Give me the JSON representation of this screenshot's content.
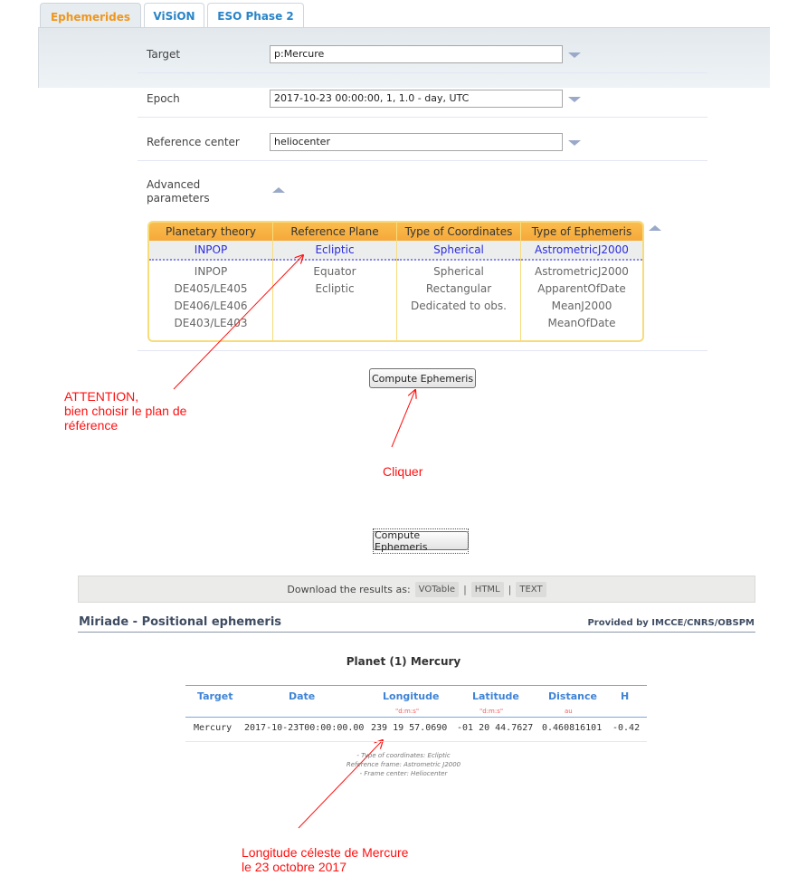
{
  "tabs": [
    {
      "label": "Ephemerides",
      "active": true
    },
    {
      "label": "ViSiON",
      "active": false
    },
    {
      "label": "ESO Phase 2",
      "active": false
    }
  ],
  "form": {
    "target": {
      "label": "Target",
      "value": "p:Mercure"
    },
    "epoch": {
      "label": "Epoch",
      "value": "2017-10-23 00:00:00, 1, 1.0 - day, UTC"
    },
    "reference_center": {
      "label": "Reference center",
      "value": "heliocenter"
    },
    "advanced": {
      "label_line1": "Advanced",
      "label_line2": "parameters"
    }
  },
  "advanced_table": {
    "columns": [
      {
        "header": "Planetary theory",
        "selected": "INPOP",
        "options": [
          "INPOP",
          "DE405/LE405",
          "DE406/LE406",
          "DE403/LE403"
        ]
      },
      {
        "header": "Reference Plane",
        "selected": "Ecliptic",
        "options": [
          "Equator",
          "Ecliptic"
        ]
      },
      {
        "header": "Type of Coordinates",
        "selected": "Spherical",
        "options": [
          "Spherical",
          "Rectangular",
          "Dedicated to obs."
        ]
      },
      {
        "header": "Type of Ephemeris",
        "selected": "AstrometricJ2000",
        "options": [
          "AstrometricJ2000",
          "ApparentOfDate",
          "MeanJ2000",
          "MeanOfDate"
        ]
      }
    ]
  },
  "compute_button": "Compute Ephemeris",
  "annotations": {
    "attention_line1": "ATTENTION,",
    "attention_line2": "bien choisir le plan de",
    "attention_line3": "référence",
    "click": "Cliquer",
    "longitude_line1": "Longitude céleste de Mercure",
    "longitude_line2": "le 23 octobre 2017",
    "color": "#ff1010"
  },
  "download": {
    "label": "Download the results as:",
    "links": [
      "VOTable",
      "HTML",
      "TEXT"
    ],
    "separator": "|"
  },
  "results": {
    "section_title": "Miriade - Positional ephemeris",
    "provider": "Provided by IMCCE/CNRS/OBSPM",
    "planet_title": "Planet (1) Mercury",
    "headers": [
      "Target",
      "Date",
      "Longitude",
      "Latitude",
      "Distance",
      "H"
    ],
    "units": [
      "",
      "",
      "\"d:m:s\"",
      "\"d:m:s\"",
      "au",
      ""
    ],
    "rows": [
      [
        "Mercury",
        "2017-10-23T00:00:00.00",
        "239 19 57.0690",
        "-01 20 44.7627",
        "0.460816101",
        "-0.42"
      ]
    ],
    "notes": [
      "- Type of coordinates: Ecliptic",
      "Reference frame: Astrometric J2000",
      "- Frame center: Heliocenter"
    ]
  },
  "colors": {
    "active_tab": "#f0961c",
    "tab_text": "#2a84c7",
    "selected_option": "#2b2bdc",
    "table_header": "#3f84d5",
    "unit": "#f06060",
    "accent_orange": "#f5a93a"
  }
}
